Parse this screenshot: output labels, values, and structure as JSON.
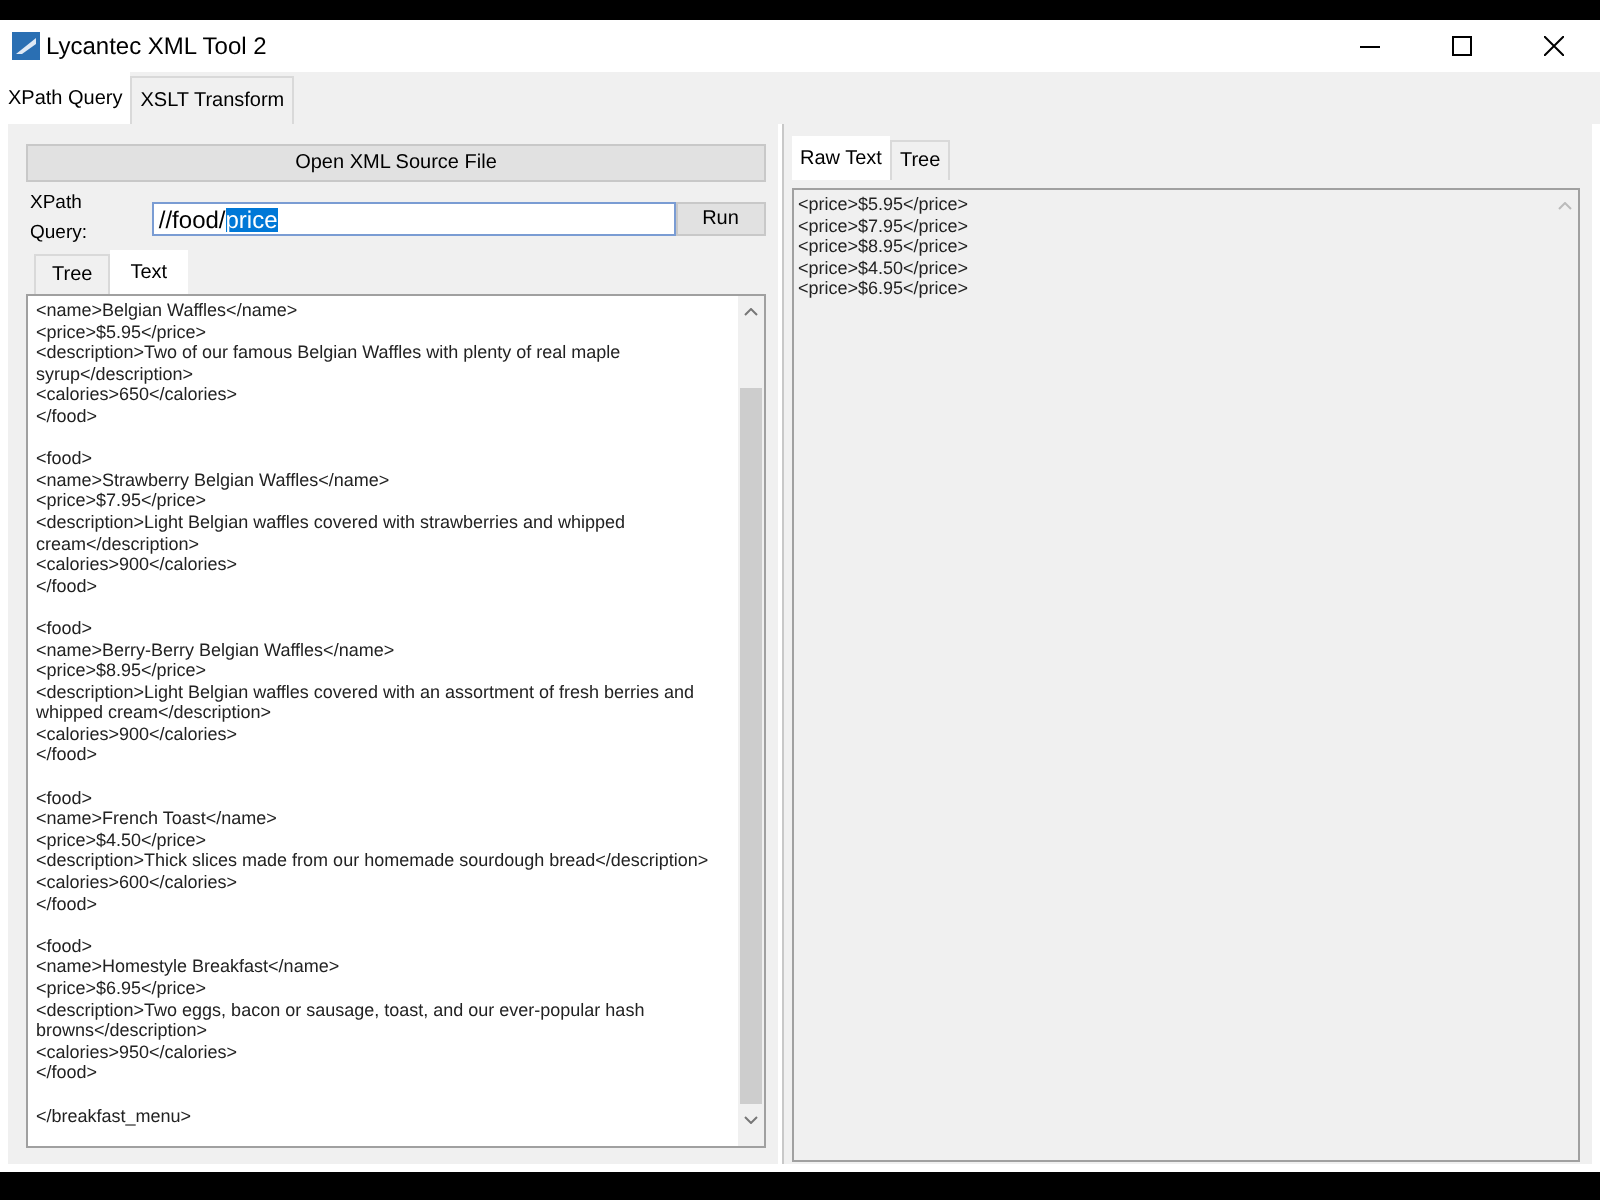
{
  "window": {
    "title": "Lycantec XML Tool 2"
  },
  "tabs": [
    {
      "label": "XPath Query",
      "selected": true
    },
    {
      "label": "XSLT Transform",
      "selected": false
    }
  ],
  "open_button": "Open XML Source File",
  "query": {
    "label": "XPath Query:",
    "value": "//food/",
    "selected_part": "price",
    "run_button": "Run"
  },
  "source_tabs": [
    {
      "label": "Tree",
      "selected": false
    },
    {
      "label": "Text",
      "selected": true
    }
  ],
  "source_blocks": [
    [
      "<name>Belgian Waffles</name>",
      "<price>$5.95</price>",
      "<description>Two of our famous Belgian Waffles with plenty of real maple",
      "syrup</description>",
      "<calories>650</calories>",
      "</food>"
    ],
    [
      "<food>",
      "<name>Strawberry Belgian Waffles</name>",
      "<price>$7.95</price>",
      "<description>Light Belgian waffles covered with strawberries and whipped",
      "cream</description>",
      "<calories>900</calories>",
      "</food>"
    ],
    [
      "<food>",
      "<name>Berry-Berry Belgian Waffles</name>",
      "<price>$8.95</price>",
      "<description>Light Belgian waffles covered with an assortment of fresh berries and",
      "whipped cream</description>",
      "<calories>900</calories>",
      "</food>"
    ],
    [
      "<food>",
      "<name>French Toast</name>",
      "<price>$4.50</price>",
      "<description>Thick slices made from our homemade sourdough bread</description>",
      "<calories>600</calories>",
      "</food>"
    ],
    [
      "<food>",
      "<name>Homestyle Breakfast</name>",
      "<price>$6.95</price>",
      "<description>Two eggs, bacon or sausage, toast, and our ever-popular hash",
      "browns</description>",
      "<calories>950</calories>",
      "</food>"
    ],
    [
      "</breakfast_menu>"
    ]
  ],
  "result_tabs": [
    {
      "label": "Raw Text",
      "selected": true
    },
    {
      "label": "Tree",
      "selected": false
    }
  ],
  "result_lines": [
    "<price>$5.95</price>",
    "<price>$7.95</price>",
    "<price>$8.95</price>",
    "<price>$4.50</price>",
    "<price>$6.95</price>"
  ]
}
